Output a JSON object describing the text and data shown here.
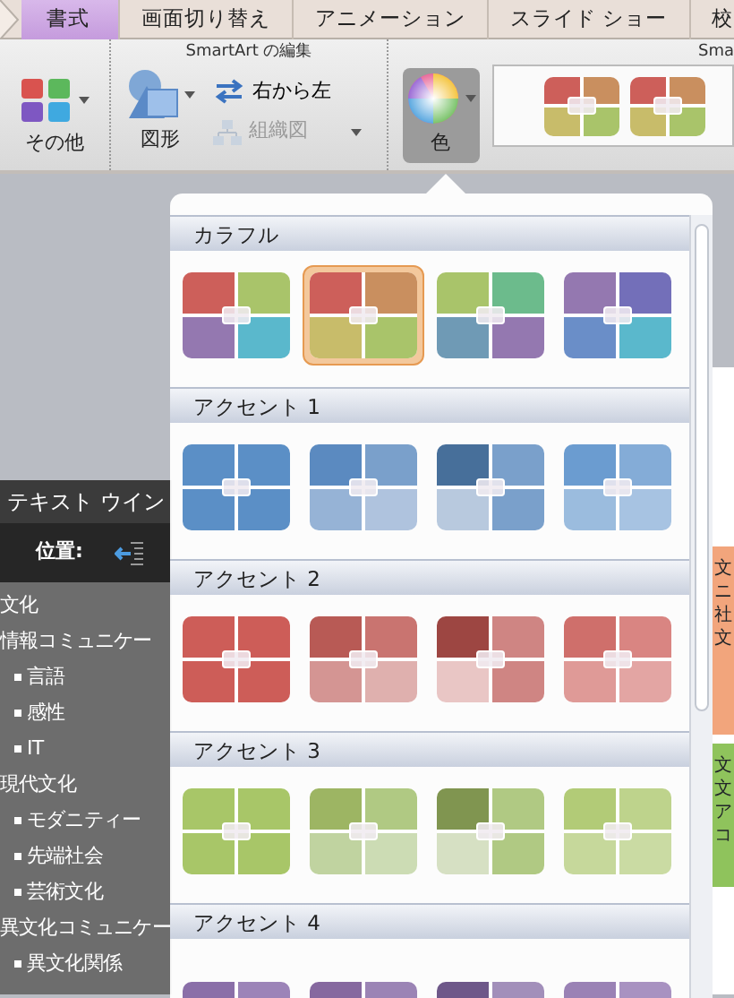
{
  "tabs": [
    {
      "label": "書式",
      "selected": true
    },
    {
      "label": "画面切り替え",
      "selected": false
    },
    {
      "label": "アニメーション",
      "selected": false
    },
    {
      "label": "スライド ショー",
      "selected": false
    },
    {
      "label": "校",
      "selected": false
    }
  ],
  "ribbon": {
    "group_labels": [
      "SmartArt の編集",
      "Sma"
    ],
    "buttons": [
      {
        "kind": "layout",
        "label": "その他",
        "disabled": false,
        "pressed": false
      },
      {
        "kind": "shapes",
        "label": "図形",
        "disabled": false,
        "pressed": false
      },
      {
        "kind": "right-to-left",
        "label": "右から左",
        "disabled": false,
        "pressed": false
      },
      {
        "kind": "org-chart",
        "label": "組織図",
        "disabled": true,
        "pressed": false
      },
      {
        "kind": "color",
        "label": "色",
        "disabled": false,
        "pressed": true
      }
    ],
    "gallery": [
      {
        "quadrants": [
          {
            "color": "#cd5f5a"
          },
          {
            "color": "#c98f5f"
          },
          {
            "color": "#c8bc6a"
          },
          {
            "color": "#a9c46a"
          }
        ]
      },
      {
        "quadrants": [
          {
            "color": "#cd5f5a"
          },
          {
            "color": "#c98f5f"
          },
          {
            "color": "#c8bc6a"
          },
          {
            "color": "#a9c46a"
          }
        ]
      }
    ]
  },
  "text_pane": {
    "title": "テキスト ウイン",
    "position_label": "位置:",
    "outline": [
      {
        "text": "文化"
      },
      {
        "text": "情報コミュニケー",
        "children": [
          {
            "text": "言語"
          },
          {
            "text": "感性"
          },
          {
            "text": "IT"
          }
        ]
      },
      {
        "text": "現代文化",
        "children": [
          {
            "text": "モダニティー"
          },
          {
            "text": "先端社会"
          },
          {
            "text": "芸術文化"
          }
        ]
      },
      {
        "text": "異文化コミュニケー",
        "children": [
          {
            "text": "異文化関係"
          }
        ]
      }
    ]
  },
  "slide_panels": [
    {
      "color": "#f2a57c",
      "texts": [
        "文",
        "ニ",
        "社",
        "文"
      ]
    },
    {
      "color": "#8fc35c",
      "texts": [
        "文",
        "文",
        "ア",
        "コ"
      ]
    }
  ],
  "color_menu": {
    "sections": [
      {
        "title": "カラフル",
        "options": [
          {
            "selected": false,
            "quadrants": [
              {
                "color": "#cd5f5a"
              },
              {
                "color": "#a9c46a"
              },
              {
                "color": "#9478b0"
              },
              {
                "color": "#5ab8cc"
              }
            ]
          },
          {
            "selected": true,
            "quadrants": [
              {
                "color": "#cd5f5a"
              },
              {
                "color": "#c98f5f"
              },
              {
                "color": "#c8bc6a"
              },
              {
                "color": "#a9c46a"
              }
            ]
          },
          {
            "selected": false,
            "quadrants": [
              {
                "color": "#a9c46a"
              },
              {
                "color": "#6cbb8c"
              },
              {
                "color": "#6f9ab5"
              },
              {
                "color": "#9478b0"
              }
            ]
          },
          {
            "selected": false,
            "quadrants": [
              {
                "color": "#9478b0"
              },
              {
                "color": "#736fb9"
              },
              {
                "color": "#6a8ec8"
              },
              {
                "color": "#5ab8cc"
              }
            ]
          }
        ]
      },
      {
        "title": "アクセント 1",
        "options": [
          {
            "selected": false,
            "quadrants": [
              {
                "color": "#5b8fc6"
              },
              {
                "color": "#5b8fc6"
              },
              {
                "color": "#5b8fc6"
              },
              {
                "color": "#5b8fc6"
              }
            ]
          },
          {
            "selected": false,
            "quadrants": [
              {
                "color": "#5b8ac0"
              },
              {
                "color": "#7aa0cb"
              },
              {
                "color": "#96b3d6"
              },
              {
                "color": "#afc3de"
              }
            ]
          },
          {
            "selected": false,
            "quadrants": [
              {
                "color": "#476f9a"
              },
              {
                "color": "#7aa0cb"
              },
              {
                "color": "#b8c9de"
              },
              {
                "color": "#7aa0cb"
              }
            ]
          },
          {
            "selected": false,
            "quadrants": [
              {
                "color": "#6b9cd0"
              },
              {
                "color": "#84acd7"
              },
              {
                "color": "#9bbcde"
              },
              {
                "color": "#a7c3e2"
              }
            ]
          }
        ]
      },
      {
        "title": "アクセント 2",
        "options": [
          {
            "selected": false,
            "quadrants": [
              {
                "color": "#cd5d58"
              },
              {
                "color": "#cd5d58"
              },
              {
                "color": "#cd5d58"
              },
              {
                "color": "#cd5d58"
              }
            ]
          },
          {
            "selected": false,
            "quadrants": [
              {
                "color": "#b85a55"
              },
              {
                "color": "#c97470"
              },
              {
                "color": "#d49593"
              },
              {
                "color": "#dfb0ae"
              }
            ]
          },
          {
            "selected": false,
            "quadrants": [
              {
                "color": "#9d4642"
              },
              {
                "color": "#cf8583"
              },
              {
                "color": "#e9c6c5"
              },
              {
                "color": "#cf8583"
              }
            ]
          },
          {
            "selected": false,
            "quadrants": [
              {
                "color": "#cf6f6b"
              },
              {
                "color": "#d98582"
              },
              {
                "color": "#df9a97"
              },
              {
                "color": "#e3a5a3"
              }
            ]
          }
        ]
      },
      {
        "title": "アクセント 3",
        "options": [
          {
            "selected": false,
            "quadrants": [
              {
                "color": "#a8c668"
              },
              {
                "color": "#a8c668"
              },
              {
                "color": "#a8c668"
              },
              {
                "color": "#a8c668"
              }
            ]
          },
          {
            "selected": false,
            "quadrants": [
              {
                "color": "#9db563"
              },
              {
                "color": "#b0c983"
              },
              {
                "color": "#c0d3a0"
              },
              {
                "color": "#ccdcb4"
              }
            ]
          },
          {
            "selected": false,
            "quadrants": [
              {
                "color": "#809550"
              },
              {
                "color": "#b0c983"
              },
              {
                "color": "#d6e0c3"
              },
              {
                "color": "#b0c983"
              }
            ]
          },
          {
            "selected": false,
            "quadrants": [
              {
                "color": "#b2cb77"
              },
              {
                "color": "#bed38c"
              },
              {
                "color": "#c6d89b"
              },
              {
                "color": "#cadba3"
              }
            ]
          }
        ]
      },
      {
        "title": "アクセント 4",
        "options": [
          {
            "selected": false,
            "quadrants": [
              {
                "color": "#8a6fa8"
              },
              {
                "color": "#9c84b8"
              }
            ]
          },
          {
            "selected": false,
            "quadrants": [
              {
                "color": "#86699f"
              },
              {
                "color": "#9b84b5"
              }
            ]
          },
          {
            "selected": false,
            "quadrants": [
              {
                "color": "#6e5889"
              },
              {
                "color": "#a28fba"
              }
            ]
          },
          {
            "selected": false,
            "quadrants": [
              {
                "color": "#9a82b5"
              },
              {
                "color": "#a892c1"
              }
            ]
          }
        ]
      }
    ]
  }
}
